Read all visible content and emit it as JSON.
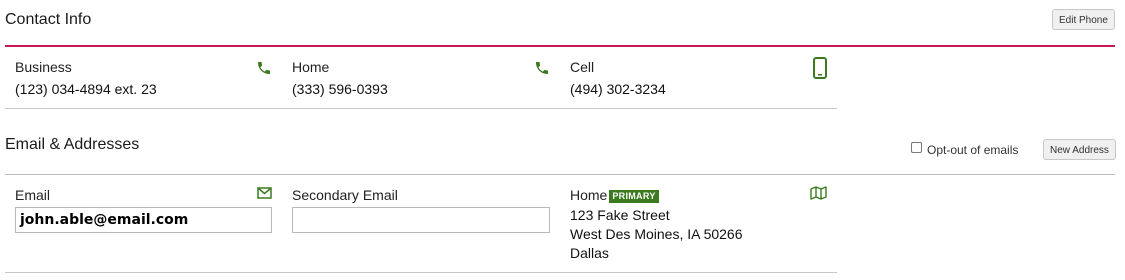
{
  "contact": {
    "title": "Contact Info",
    "edit_phone_label": "Edit Phone",
    "phones": [
      {
        "label": "Business",
        "value": "(123) 034-4894 ext. 23",
        "icon": "phone-icon"
      },
      {
        "label": "Home",
        "value": "(333) 596-0393",
        "icon": "phone-icon"
      },
      {
        "label": "Cell",
        "value": "(494) 302-3234",
        "icon": "mobile-phone-icon"
      }
    ]
  },
  "email_addresses": {
    "title": "Email & Addresses",
    "opt_out_label": "Opt-out of emails",
    "opt_out_checked": false,
    "new_address_label": "New Address",
    "email": {
      "label": "Email",
      "value": "john.able@email.com",
      "icon": "envelope-icon"
    },
    "secondary_email": {
      "label": "Secondary Email",
      "value": ""
    },
    "address": {
      "label": "Home",
      "badge": "PRIMARY",
      "street": "123 Fake Street",
      "city_state_zip": "West Des Moines, IA 50266",
      "extra": "Dallas",
      "icon": "map-icon"
    }
  },
  "colors": {
    "accent_rule": "#c2185b",
    "icon_green": "#3b7a1e",
    "badge_bg": "#3b7a1e"
  }
}
